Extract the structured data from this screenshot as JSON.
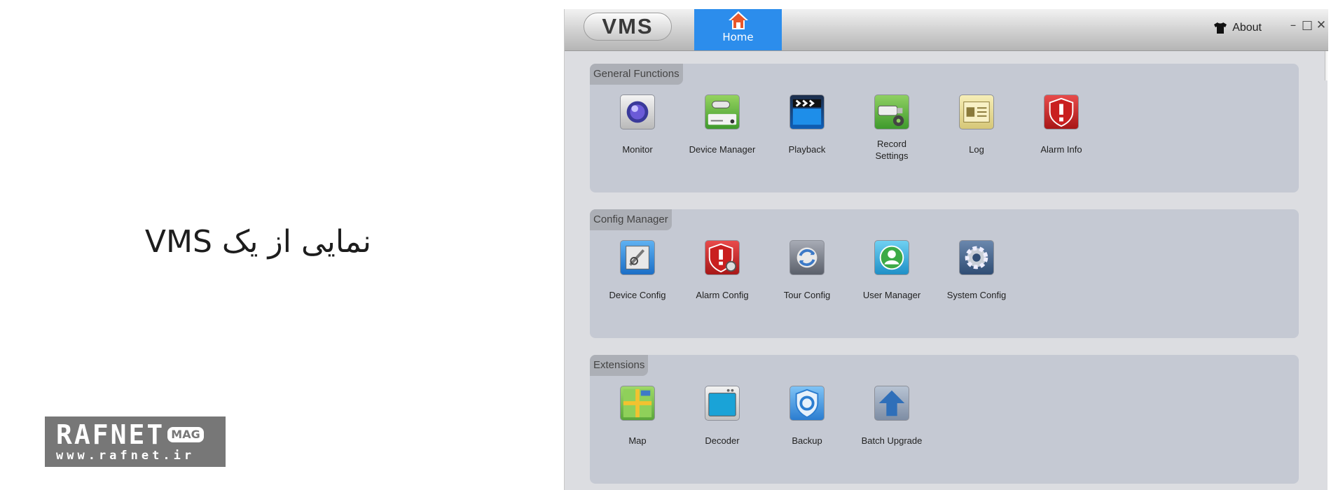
{
  "caption": "نمایی از یک VMS",
  "watermark": {
    "main": "RAFNET",
    "badge": "MAG",
    "url": "www.rafnet.ir"
  },
  "window": {
    "logo": "VMS",
    "home_tab": "Home",
    "about": "About",
    "controls": {
      "minimize": "–",
      "maximize": "□",
      "close": "✕"
    }
  },
  "sections": [
    {
      "title": "General Functions",
      "items": [
        {
          "label": "Monitor",
          "icon": "monitor-camera-icon"
        },
        {
          "label": "Device Manager",
          "icon": "device-manager-icon"
        },
        {
          "label": "Playback",
          "icon": "playback-clapper-icon"
        },
        {
          "label": "Record\nSettings",
          "icon": "record-settings-icon"
        },
        {
          "label": "Log",
          "icon": "log-icon"
        },
        {
          "label": "Alarm Info",
          "icon": "alarm-shield-icon"
        }
      ]
    },
    {
      "title": "Config Manager",
      "items": [
        {
          "label": "Device Config",
          "icon": "device-config-icon"
        },
        {
          "label": "Alarm Config",
          "icon": "alarm-config-icon"
        },
        {
          "label": "Tour Config",
          "icon": "tour-config-icon"
        },
        {
          "label": "User Manager",
          "icon": "user-manager-icon"
        },
        {
          "label": "System Config",
          "icon": "system-config-gear-icon"
        }
      ]
    },
    {
      "title": "Extensions",
      "items": [
        {
          "label": "Map",
          "icon": "map-icon"
        },
        {
          "label": "Decoder",
          "icon": "decoder-icon"
        },
        {
          "label": "Backup",
          "icon": "backup-icon"
        },
        {
          "label": "Batch Upgrade",
          "icon": "batch-upgrade-arrow-icon"
        }
      ]
    }
  ],
  "colors": {
    "accent": "#2c8dec",
    "panel": "#c5c9d3",
    "window_bg": "#dcdde1",
    "panel_label_bg": "#acafb6"
  }
}
